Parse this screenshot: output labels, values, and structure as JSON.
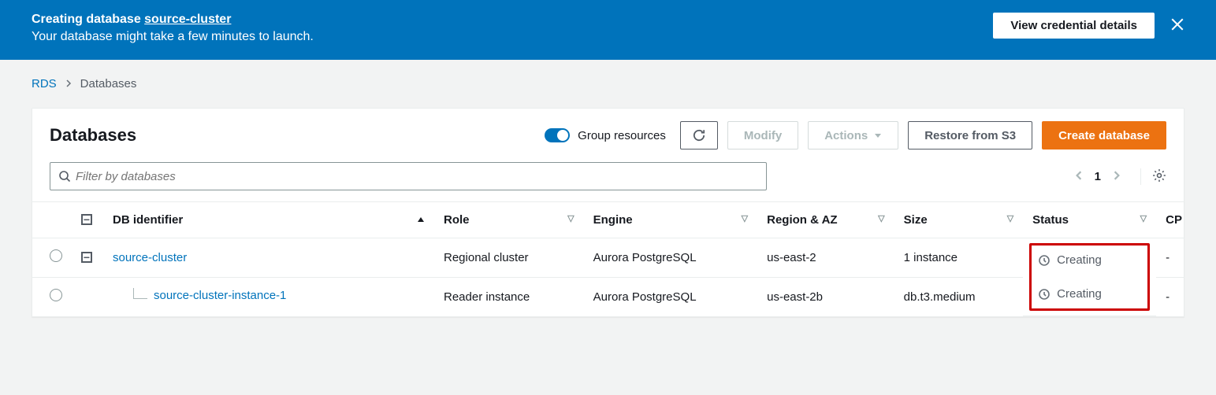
{
  "notification": {
    "title_prefix": "Creating database ",
    "title_link": "source-cluster",
    "subtitle": "Your database might take a few minutes to launch.",
    "view_creds_label": "View credential details"
  },
  "breadcrumb": {
    "root": "RDS",
    "current": "Databases"
  },
  "panel": {
    "title": "Databases",
    "group_toggle_label": "Group resources",
    "modify_label": "Modify",
    "actions_label": "Actions",
    "restore_label": "Restore from S3",
    "create_label": "Create database"
  },
  "filter": {
    "placeholder": "Filter by databases"
  },
  "pager": {
    "page": "1"
  },
  "table": {
    "headers": {
      "id": "DB identifier",
      "role": "Role",
      "engine": "Engine",
      "region": "Region & AZ",
      "size": "Size",
      "status": "Status",
      "cpu": "CP"
    },
    "rows": [
      {
        "id": "source-cluster",
        "role": "Regional cluster",
        "engine": "Aurora PostgreSQL",
        "region": "us-east-2",
        "size": "1 instance",
        "status": "Creating",
        "cpu": "-"
      },
      {
        "id": "source-cluster-instance-1",
        "role": "Reader instance",
        "engine": "Aurora PostgreSQL",
        "region": "us-east-2b",
        "size": "db.t3.medium",
        "status": "Creating",
        "cpu": "-"
      }
    ]
  }
}
